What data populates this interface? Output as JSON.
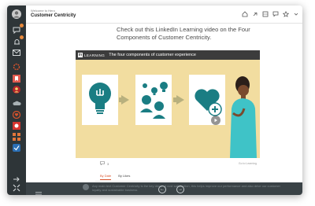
{
  "header": {
    "breadcrumb": "Welcome to Hero",
    "title": "Customer Centricity",
    "icons": [
      "home-icon",
      "link-icon",
      "grid-icon",
      "chat-icon",
      "star-icon",
      "chevron-down-icon"
    ]
  },
  "rail": {
    "icons": [
      "avatar",
      "chat-icon",
      "bell-icon",
      "mail-icon",
      "settings-icon",
      "bookmark-icon",
      "people-icon",
      "cloud-icon",
      "heart-icon",
      "grid-icon",
      "apps-icon",
      "logout-icon",
      "expand-icon"
    ],
    "badge_color": "#e8893b"
  },
  "post": {
    "headline": "Check out this LinkedIn Learning video on the Four Components of Customer Centricity."
  },
  "video": {
    "brand": "LEARNING",
    "brand_mark": "in",
    "title": "The four components of customer experience",
    "bg_color": "#f2dda0",
    "icon_color": "#1a7d83"
  },
  "engagement": {
    "comment_count": "3",
    "right_text": "Go to Learning",
    "tabs": [
      "By Date",
      "By Likes"
    ]
  },
  "footer": {
    "faded_text": "Any main text Customer Centricity is the key driver of cust satisfaction, this helps improve our performance and also drive our customer loyalty and sustainable business"
  }
}
